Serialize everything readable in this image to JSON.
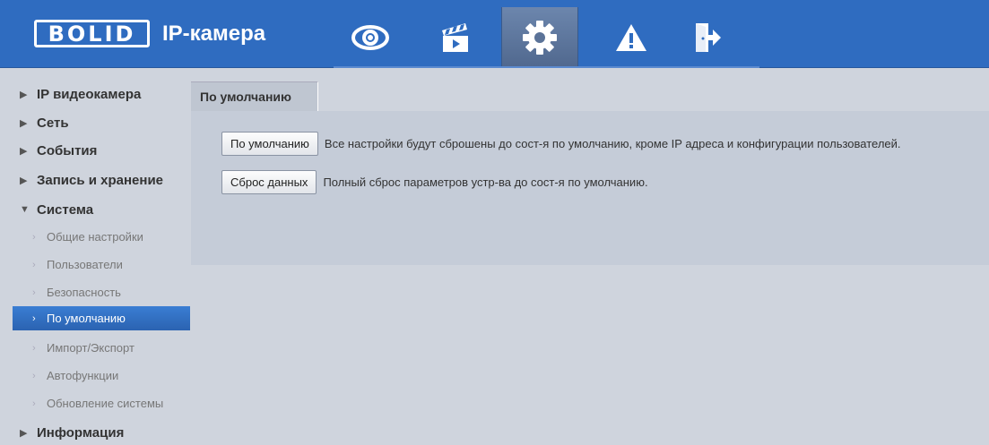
{
  "header": {
    "logo_text": "BOLID",
    "app_title": "IP-камера",
    "nav": [
      {
        "icon": "eye-icon"
      },
      {
        "icon": "clapperboard-icon"
      },
      {
        "icon": "gear-icon"
      },
      {
        "icon": "warning-icon"
      },
      {
        "icon": "logout-icon"
      }
    ],
    "active_nav": "gear-icon",
    "colors": {
      "header_bg": "#2f6cc0",
      "active_tab": "#5b7398"
    }
  },
  "sidebar": {
    "sections": [
      {
        "label": "IP видеокамера"
      },
      {
        "label": "Сеть"
      },
      {
        "label": "События"
      },
      {
        "label": "Запись и хранение"
      },
      {
        "label": "Система",
        "expanded": true
      },
      {
        "label": "Информация"
      }
    ],
    "system_items": [
      {
        "label": "Общие настройки"
      },
      {
        "label": "Пользователи"
      },
      {
        "label": "Безопасность"
      },
      {
        "label": "По умолчанию",
        "active": true
      },
      {
        "label": "Импорт/Экспорт"
      },
      {
        "label": "Автофункции"
      },
      {
        "label": "Обновление системы"
      }
    ],
    "colors": {
      "active_item": "#2f6cc0"
    }
  },
  "content": {
    "tab_label": "По умолчанию",
    "rows": [
      {
        "button": "По умолчанию",
        "description": "Все настройки будут сброшены до сост-я по умолчанию, кроме IP адреса и конфигурации пользователей."
      },
      {
        "button": "Сброс данных",
        "description": "Полный сброс параметров устр-ва до сост-я по умолчанию."
      }
    ]
  }
}
